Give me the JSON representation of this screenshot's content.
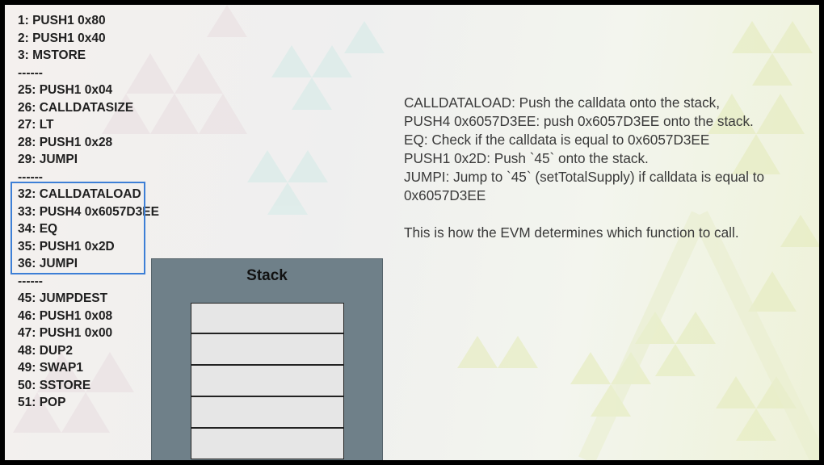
{
  "listing": [
    "1: PUSH1 0x80",
    "2: PUSH1 0x40",
    "3: MSTORE",
    "------",
    "25: PUSH1 0x04",
    "26: CALLDATASIZE",
    "27: LT",
    "28: PUSH1 0x28",
    "29: JUMPI",
    "------",
    "32: CALLDATALOAD",
    "33: PUSH4 0x6057D3EE",
    "34: EQ",
    "35: PUSH1 0x2D",
    "36: JUMPI",
    "------",
    "45: JUMPDEST",
    "46: PUSH1 0x08",
    "47: PUSH1 0x00",
    "48: DUP2",
    "49: SWAP1",
    "50: SSTORE",
    "51: POP"
  ],
  "stack": {
    "title": "Stack",
    "cells": [
      "",
      "",
      "",
      "",
      ""
    ]
  },
  "explanation": {
    "lines": [
      "CALLDATALOAD: Push the calldata onto the stack,",
      "PUSH4 0x6057D3EE: push 0x6057D3EE onto the stack.",
      "EQ: Check if the calldata is equal to 0x6057D3EE",
      "PUSH1 0x2D: Push `45` onto the stack.",
      "JUMPI: Jump to `45` (setTotalSupply) if calldata is equal to",
      "0x6057D3EE"
    ],
    "summary": "This is how the EVM determines which function to call."
  },
  "colors": {
    "highlight": "#3d7fd6",
    "stack_panel": "#6f8089",
    "stack_cell": "#e6e6e6"
  }
}
